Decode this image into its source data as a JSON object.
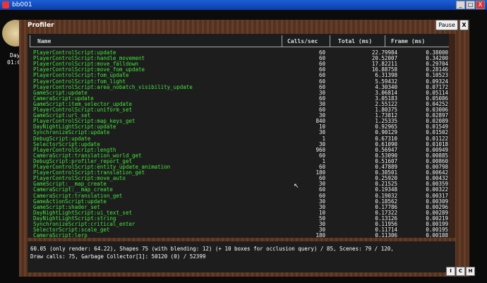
{
  "os_window": {
    "title": "bb001",
    "min_label": "_",
    "max_label": "□",
    "close_label": "X"
  },
  "hud": {
    "day_label": "Day:",
    "time_label": "01:0"
  },
  "profiler": {
    "title": "Profiler",
    "pause_label": "Pause",
    "close_label": "X",
    "columns": {
      "name": "Name",
      "calls": "Calls/sec",
      "total": "Total (ms)",
      "frame": "Frame (ms)"
    },
    "rows": [
      {
        "name": "PlayerControlScript:update",
        "calls": "60",
        "total": "22.79984",
        "frame": "0.38000"
      },
      {
        "name": "PlayerControlScript:handle_movement",
        "calls": "60",
        "total": "20.52007",
        "frame": "0.34200"
      },
      {
        "name": "PlayerControlScript:move_falldown",
        "calls": "60",
        "total": "17.82211",
        "frame": "0.29704"
      },
      {
        "name": "PlayerControlScript:move_fom_update",
        "calls": "60",
        "total": "16.88758",
        "frame": "0.28146"
      },
      {
        "name": "PlayerControlScript:fom_update",
        "calls": "60",
        "total": "6.31398",
        "frame": "0.10523"
      },
      {
        "name": "PlayerControlScript:fom_light",
        "calls": "60",
        "total": "5.59432",
        "frame": "0.09324"
      },
      {
        "name": "PlayerControlScript:area_nobatch_visibility_update",
        "calls": "60",
        "total": "4.30340",
        "frame": "0.07172"
      },
      {
        "name": "GameScript:update",
        "calls": "30",
        "total": "3.06814",
        "frame": "0.05114"
      },
      {
        "name": "CameraScript:update",
        "calls": "60",
        "total": "3.05183",
        "frame": "0.05086"
      },
      {
        "name": "GameScript:item_selector_update",
        "calls": "30",
        "total": "2.55122",
        "frame": "0.04252"
      },
      {
        "name": "PlayerControlScript:uniform_set",
        "calls": "60",
        "total": "1.80375",
        "frame": "0.03006"
      },
      {
        "name": "GameScript:url_set",
        "calls": "30",
        "total": "1.73812",
        "frame": "0.02897"
      },
      {
        "name": "PlayerControlScript:map_keys_get",
        "calls": "840",
        "total": "1.25335",
        "frame": "0.02089"
      },
      {
        "name": "DayNightLightScript:update",
        "calls": "10",
        "total": "0.92965",
        "frame": "0.01549"
      },
      {
        "name": "SynchronizeScript:update",
        "calls": "30",
        "total": "0.90129",
        "frame": "0.01502"
      },
      {
        "name": "DebugScript:update",
        "calls": "1",
        "total": "0.67310",
        "frame": "0.01122"
      },
      {
        "name": "SelectorScript:update",
        "calls": "30",
        "total": "0.61090",
        "frame": "0.01018"
      },
      {
        "name": "PlayerControlScript:length",
        "calls": "960",
        "total": "0.56947",
        "frame": "0.00949"
      },
      {
        "name": "CameraScript:translation_world_get",
        "calls": "60",
        "total": "0.53090",
        "frame": "0.00885"
      },
      {
        "name": "DebugScript:profiler_report_get",
        "calls": "1",
        "total": "0.51607",
        "frame": "0.00860"
      },
      {
        "name": "PlayerControlScript:entity_update_animation",
        "calls": "60",
        "total": "0.47889",
        "frame": "0.00798"
      },
      {
        "name": "PlayerControlScript:translation_get",
        "calls": "180",
        "total": "0.38501",
        "frame": "0.00642"
      },
      {
        "name": "PlayerControlScript:move_auto",
        "calls": "60",
        "total": "0.25920",
        "frame": "0.00432"
      },
      {
        "name": "GameScript:__map_create",
        "calls": "30",
        "total": "0.21525",
        "frame": "0.00359"
      },
      {
        "name": "CameraScript:__map_create",
        "calls": "60",
        "total": "0.19348",
        "frame": "0.00322"
      },
      {
        "name": "CameraScript:translation_get",
        "calls": "60",
        "total": "0.19032",
        "frame": "0.00317"
      },
      {
        "name": "GameActionScript:update",
        "calls": "30",
        "total": "0.18562",
        "frame": "0.00309"
      },
      {
        "name": "GameScript:shader_set",
        "calls": "30",
        "total": "0.17786",
        "frame": "0.00296"
      },
      {
        "name": "DayNightLightScript:ui_text_set",
        "calls": "10",
        "total": "0.17322",
        "frame": "0.00289"
      },
      {
        "name": "DayNightLightScript:string",
        "calls": "50",
        "total": "0.13126",
        "frame": "0.00219"
      },
      {
        "name": "SynchronizeScript:critical_enter",
        "calls": "30",
        "total": "0.11956",
        "frame": "0.00199"
      },
      {
        "name": "SelectorScript:scale_get",
        "calls": "30",
        "total": "0.11714",
        "frame": "0.00195"
      },
      {
        "name": "CameraScript:lerp",
        "calls": "180",
        "total": "0.11306",
        "frame": "0.00188"
      }
    ],
    "status_line1": "60.05 (only render: 64.22), Shapes 75 (with blending: 12) (+ 10 boxes for occlusion query) / 85, Scenes: 79 / 120,",
    "status_line2": "Draw calls: 75, Garbage Collector[1]: 50120 (0) / 52399"
  },
  "toolbar": {
    "btn_i": "I",
    "btn_c": "C",
    "btn_h": "H"
  },
  "colors": {
    "name_text": "#42e63a",
    "value_text": "#f2f2f2",
    "frame_wood": "#5a3420",
    "panel_bg": "#1d1d1d"
  }
}
